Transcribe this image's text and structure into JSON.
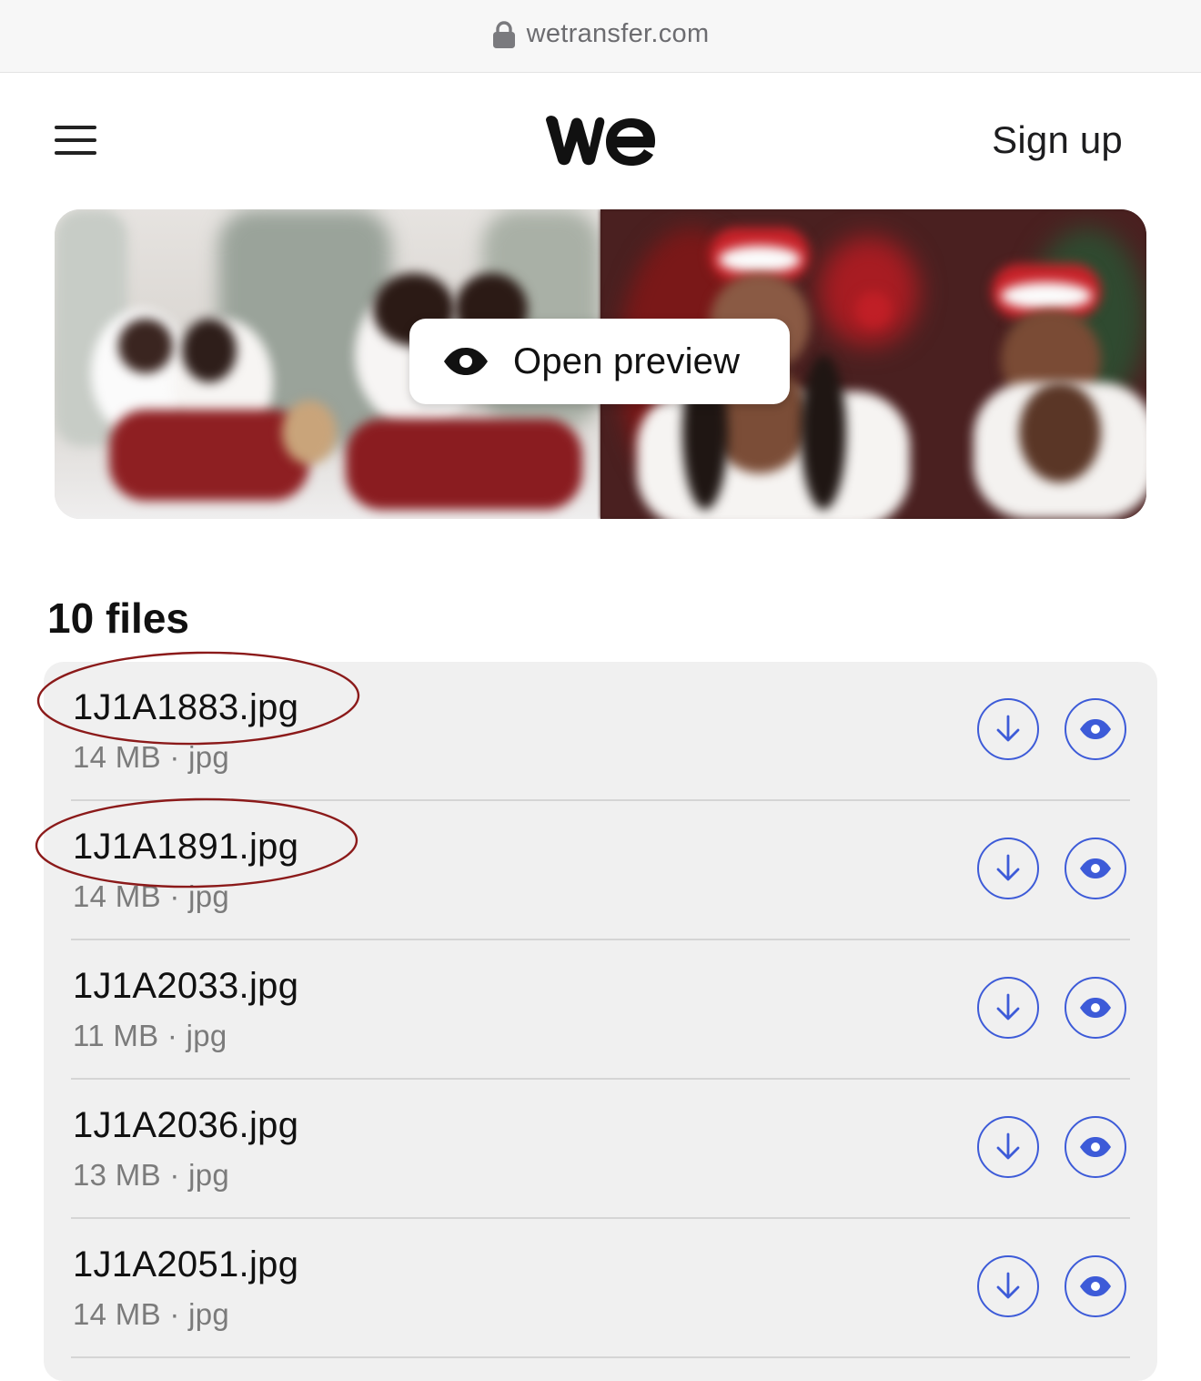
{
  "browser": {
    "url": "wetransfer.com",
    "lock_icon": "lock-icon"
  },
  "header": {
    "menu_icon": "hamburger-menu-icon",
    "logo_icon": "wetransfer-we-logo",
    "signup_label": "Sign up"
  },
  "preview": {
    "button_label": "Open preview",
    "button_icon": "eye-icon"
  },
  "files": {
    "count_label": "10 files",
    "items": [
      {
        "name": "1J1A1883.jpg",
        "meta": "14 MB · jpg"
      },
      {
        "name": "1J1A1891.jpg",
        "meta": "14 MB · jpg"
      },
      {
        "name": "1J1A2033.jpg",
        "meta": "11 MB · jpg"
      },
      {
        "name": "1J1A2036.jpg",
        "meta": "13 MB · jpg"
      },
      {
        "name": "1J1A2051.jpg",
        "meta": "14 MB · jpg"
      }
    ],
    "row_icons": [
      "download-arrow-icon",
      "eye-icon"
    ]
  },
  "colors": {
    "accent": "#3d5bd8",
    "annotation": "#8b1a1a",
    "list_background": "#f0f0f0"
  }
}
